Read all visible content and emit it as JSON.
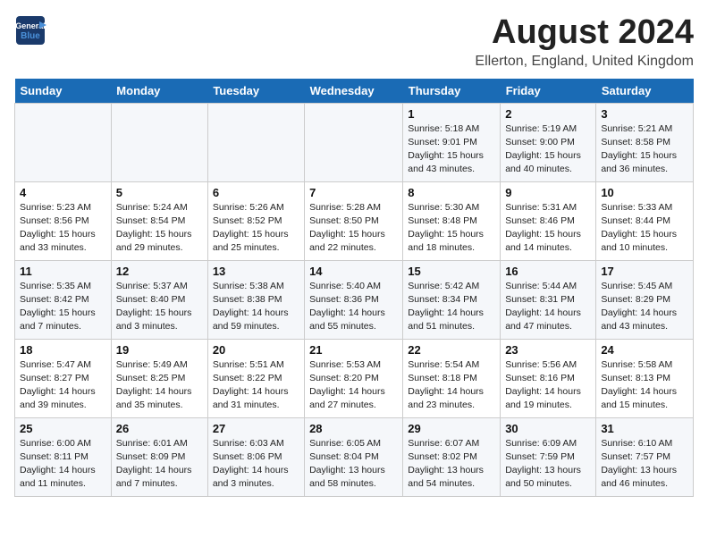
{
  "header": {
    "logo_line1": "General",
    "logo_line2": "Blue",
    "month_year": "August 2024",
    "location": "Ellerton, England, United Kingdom"
  },
  "weekdays": [
    "Sunday",
    "Monday",
    "Tuesday",
    "Wednesday",
    "Thursday",
    "Friday",
    "Saturday"
  ],
  "weeks": [
    [
      {
        "day": "",
        "info": ""
      },
      {
        "day": "",
        "info": ""
      },
      {
        "day": "",
        "info": ""
      },
      {
        "day": "",
        "info": ""
      },
      {
        "day": "1",
        "info": "Sunrise: 5:18 AM\nSunset: 9:01 PM\nDaylight: 15 hours\nand 43 minutes."
      },
      {
        "day": "2",
        "info": "Sunrise: 5:19 AM\nSunset: 9:00 PM\nDaylight: 15 hours\nand 40 minutes."
      },
      {
        "day": "3",
        "info": "Sunrise: 5:21 AM\nSunset: 8:58 PM\nDaylight: 15 hours\nand 36 minutes."
      }
    ],
    [
      {
        "day": "4",
        "info": "Sunrise: 5:23 AM\nSunset: 8:56 PM\nDaylight: 15 hours\nand 33 minutes."
      },
      {
        "day": "5",
        "info": "Sunrise: 5:24 AM\nSunset: 8:54 PM\nDaylight: 15 hours\nand 29 minutes."
      },
      {
        "day": "6",
        "info": "Sunrise: 5:26 AM\nSunset: 8:52 PM\nDaylight: 15 hours\nand 25 minutes."
      },
      {
        "day": "7",
        "info": "Sunrise: 5:28 AM\nSunset: 8:50 PM\nDaylight: 15 hours\nand 22 minutes."
      },
      {
        "day": "8",
        "info": "Sunrise: 5:30 AM\nSunset: 8:48 PM\nDaylight: 15 hours\nand 18 minutes."
      },
      {
        "day": "9",
        "info": "Sunrise: 5:31 AM\nSunset: 8:46 PM\nDaylight: 15 hours\nand 14 minutes."
      },
      {
        "day": "10",
        "info": "Sunrise: 5:33 AM\nSunset: 8:44 PM\nDaylight: 15 hours\nand 10 minutes."
      }
    ],
    [
      {
        "day": "11",
        "info": "Sunrise: 5:35 AM\nSunset: 8:42 PM\nDaylight: 15 hours\nand 7 minutes."
      },
      {
        "day": "12",
        "info": "Sunrise: 5:37 AM\nSunset: 8:40 PM\nDaylight: 15 hours\nand 3 minutes."
      },
      {
        "day": "13",
        "info": "Sunrise: 5:38 AM\nSunset: 8:38 PM\nDaylight: 14 hours\nand 59 minutes."
      },
      {
        "day": "14",
        "info": "Sunrise: 5:40 AM\nSunset: 8:36 PM\nDaylight: 14 hours\nand 55 minutes."
      },
      {
        "day": "15",
        "info": "Sunrise: 5:42 AM\nSunset: 8:34 PM\nDaylight: 14 hours\nand 51 minutes."
      },
      {
        "day": "16",
        "info": "Sunrise: 5:44 AM\nSunset: 8:31 PM\nDaylight: 14 hours\nand 47 minutes."
      },
      {
        "day": "17",
        "info": "Sunrise: 5:45 AM\nSunset: 8:29 PM\nDaylight: 14 hours\nand 43 minutes."
      }
    ],
    [
      {
        "day": "18",
        "info": "Sunrise: 5:47 AM\nSunset: 8:27 PM\nDaylight: 14 hours\nand 39 minutes."
      },
      {
        "day": "19",
        "info": "Sunrise: 5:49 AM\nSunset: 8:25 PM\nDaylight: 14 hours\nand 35 minutes."
      },
      {
        "day": "20",
        "info": "Sunrise: 5:51 AM\nSunset: 8:22 PM\nDaylight: 14 hours\nand 31 minutes."
      },
      {
        "day": "21",
        "info": "Sunrise: 5:53 AM\nSunset: 8:20 PM\nDaylight: 14 hours\nand 27 minutes."
      },
      {
        "day": "22",
        "info": "Sunrise: 5:54 AM\nSunset: 8:18 PM\nDaylight: 14 hours\nand 23 minutes."
      },
      {
        "day": "23",
        "info": "Sunrise: 5:56 AM\nSunset: 8:16 PM\nDaylight: 14 hours\nand 19 minutes."
      },
      {
        "day": "24",
        "info": "Sunrise: 5:58 AM\nSunset: 8:13 PM\nDaylight: 14 hours\nand 15 minutes."
      }
    ],
    [
      {
        "day": "25",
        "info": "Sunrise: 6:00 AM\nSunset: 8:11 PM\nDaylight: 14 hours\nand 11 minutes."
      },
      {
        "day": "26",
        "info": "Sunrise: 6:01 AM\nSunset: 8:09 PM\nDaylight: 14 hours\nand 7 minutes."
      },
      {
        "day": "27",
        "info": "Sunrise: 6:03 AM\nSunset: 8:06 PM\nDaylight: 14 hours\nand 3 minutes."
      },
      {
        "day": "28",
        "info": "Sunrise: 6:05 AM\nSunset: 8:04 PM\nDaylight: 13 hours\nand 58 minutes."
      },
      {
        "day": "29",
        "info": "Sunrise: 6:07 AM\nSunset: 8:02 PM\nDaylight: 13 hours\nand 54 minutes."
      },
      {
        "day": "30",
        "info": "Sunrise: 6:09 AM\nSunset: 7:59 PM\nDaylight: 13 hours\nand 50 minutes."
      },
      {
        "day": "31",
        "info": "Sunrise: 6:10 AM\nSunset: 7:57 PM\nDaylight: 13 hours\nand 46 minutes."
      }
    ]
  ]
}
